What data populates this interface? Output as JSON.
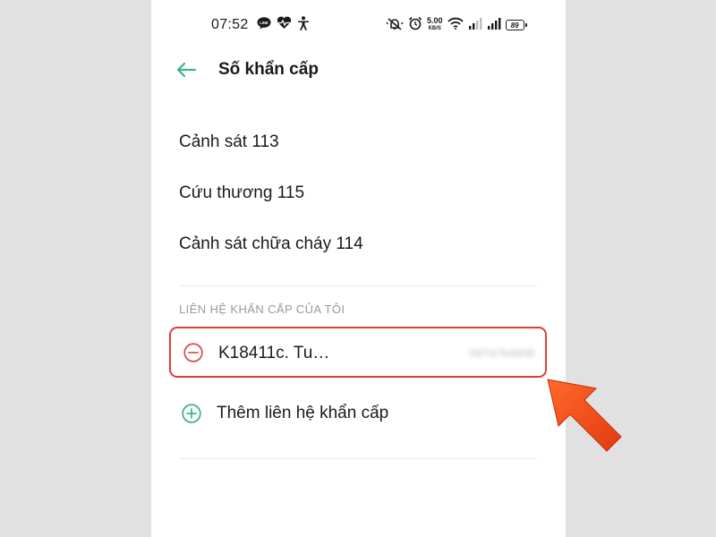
{
  "status_bar": {
    "time": "07:52",
    "net_speed_value": "5.00",
    "net_speed_unit": "KB/S",
    "battery_level": "89",
    "left_icons": [
      "line-icon",
      "heart-pulse-icon",
      "accessibility-icon"
    ],
    "right_icons": [
      "vibrate-silent-icon",
      "alarm-icon",
      "wifi-icon",
      "signal-icon",
      "signal-icon-2",
      "battery-icon"
    ]
  },
  "header": {
    "title": "Số khẩn cấp",
    "back_icon": "back-arrow-icon"
  },
  "emergency_numbers": [
    {
      "label": "Cảnh sát 113"
    },
    {
      "label": "Cứu thương 115"
    },
    {
      "label": "Cảnh sát chữa cháy 114"
    }
  ],
  "my_contacts": {
    "section_label": "LIÊN HỆ KHẨN CẤP CỦA TÔI",
    "contacts": [
      {
        "name": "K18411c. Tu…",
        "phone": "0974764908",
        "remove_icon": "remove-circle-icon"
      }
    ],
    "add_label": "Thêm liên hệ khẩn cấp",
    "add_icon": "add-circle-icon"
  },
  "colors": {
    "accent_green": "#3cb88a",
    "highlight_red": "#e23a3a",
    "remove_red": "#d9534f",
    "arrow_orange": "#f04a1a",
    "background": "#e1e1e1"
  }
}
